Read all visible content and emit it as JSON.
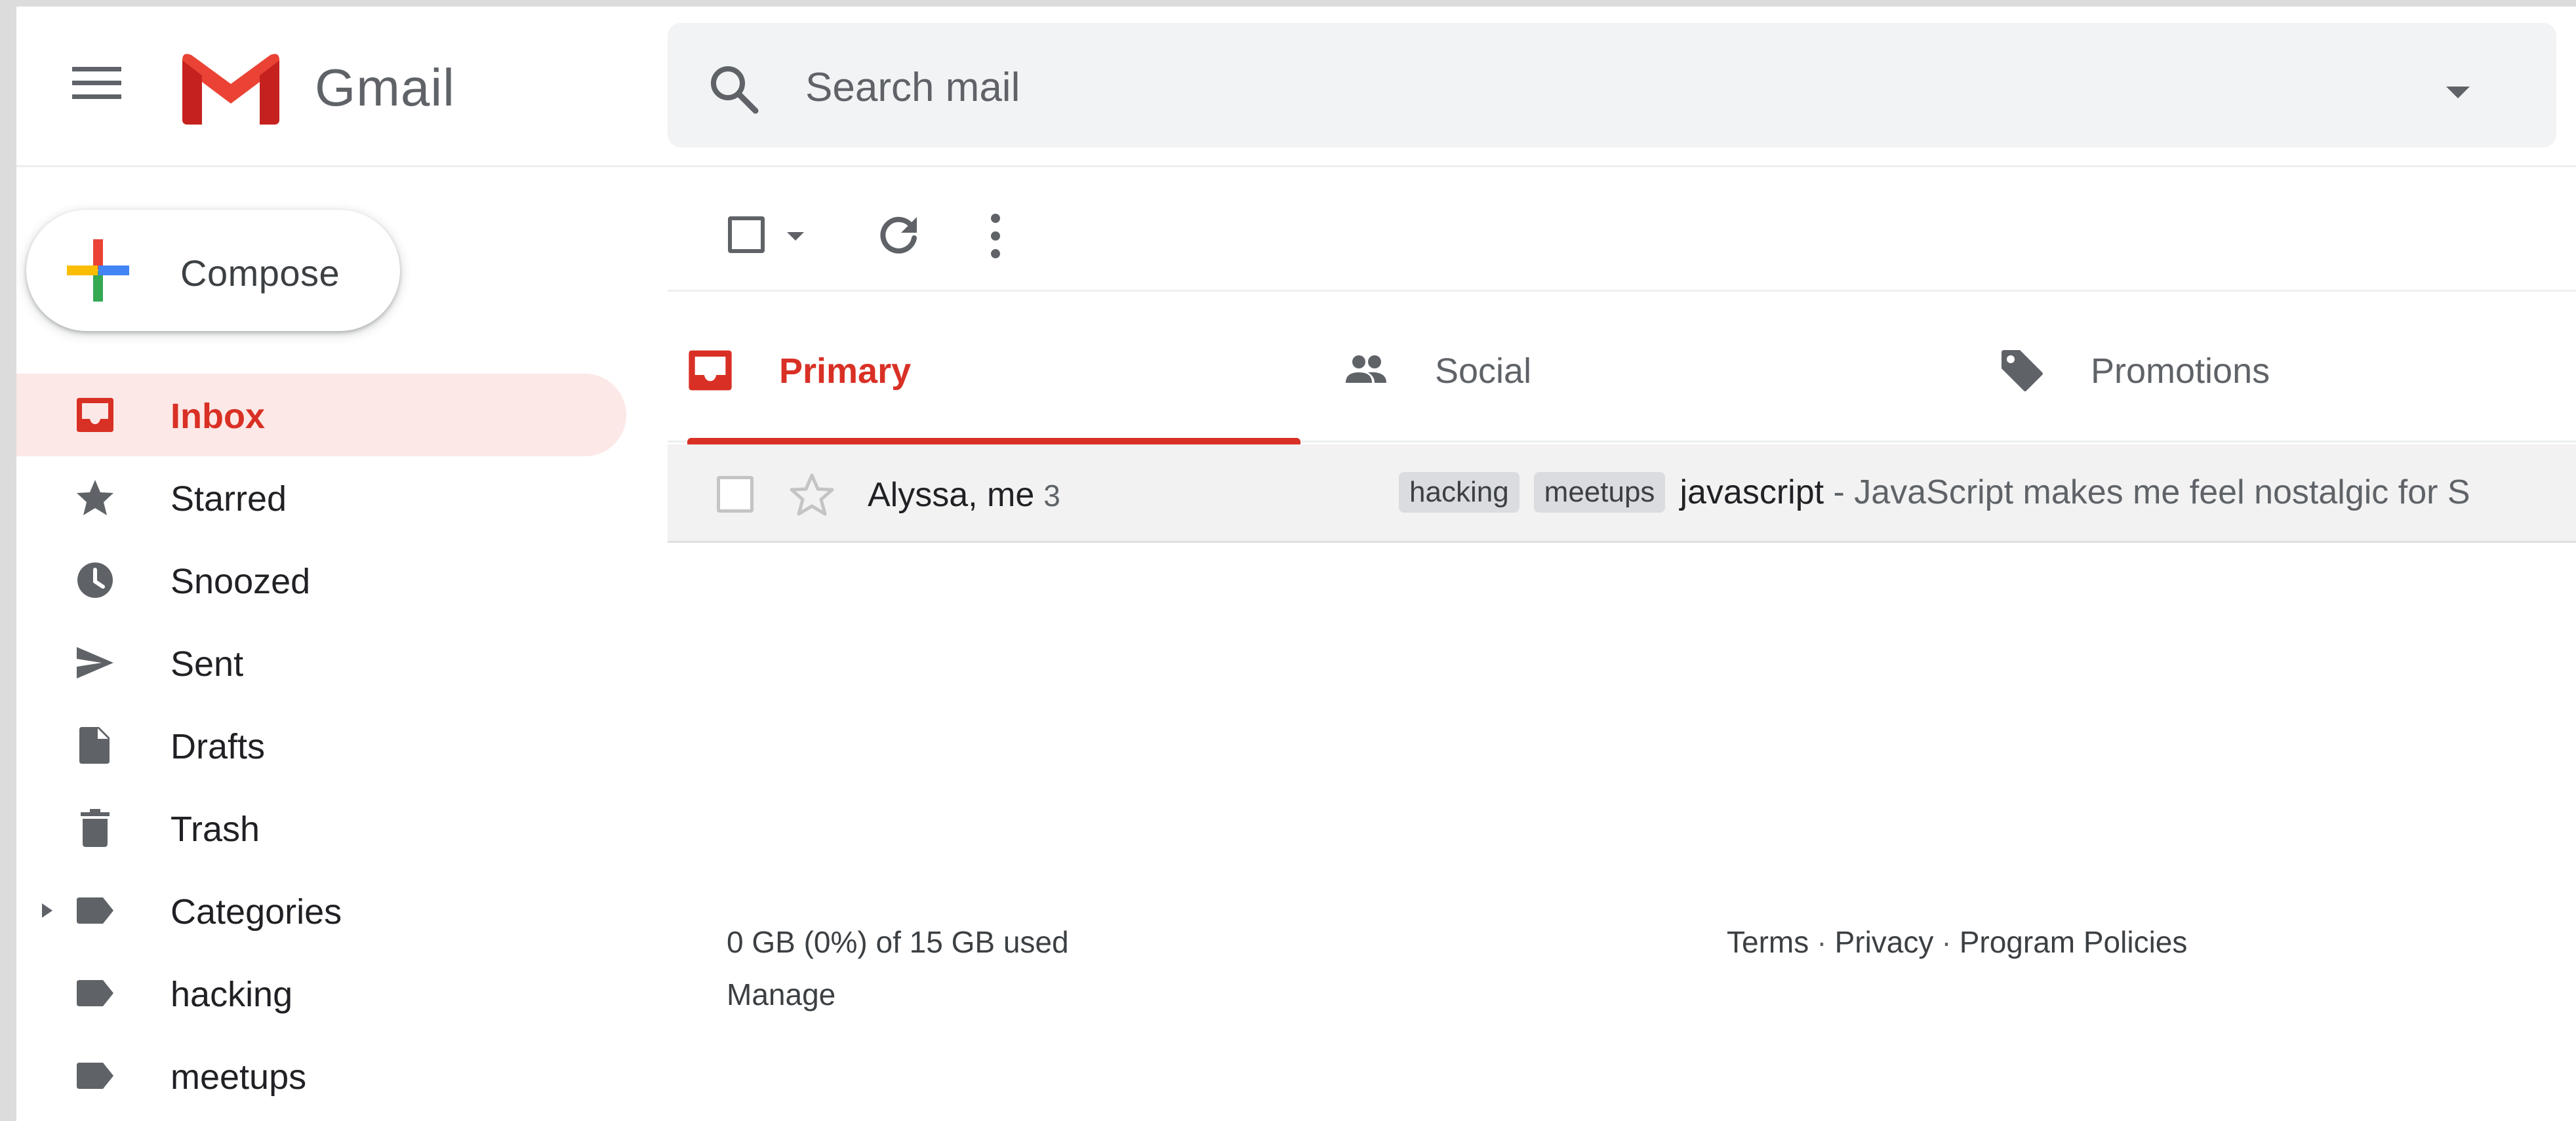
{
  "header": {
    "logo_text": "Gmail",
    "search": {
      "placeholder": "Search mail"
    }
  },
  "compose": {
    "label": "Compose"
  },
  "sidebar": {
    "items": [
      {
        "label": "Inbox",
        "icon": "inbox-icon",
        "active": true
      },
      {
        "label": "Starred",
        "icon": "star-icon"
      },
      {
        "label": "Snoozed",
        "icon": "clock-icon"
      },
      {
        "label": "Sent",
        "icon": "send-icon"
      },
      {
        "label": "Drafts",
        "icon": "draft-icon"
      },
      {
        "label": "Trash",
        "icon": "trash-icon"
      },
      {
        "label": "Categories",
        "icon": "label-icon"
      },
      {
        "label": "hacking",
        "icon": "label-icon"
      },
      {
        "label": "meetups",
        "icon": "label-icon"
      }
    ]
  },
  "tabs": [
    {
      "label": "Primary",
      "icon": "inbox-icon",
      "active": true
    },
    {
      "label": "Social",
      "icon": "people-icon"
    },
    {
      "label": "Promotions",
      "icon": "tag-icon"
    }
  ],
  "emails": [
    {
      "sender": "Alyssa, me",
      "count": "3",
      "labels": [
        "hacking",
        "meetups"
      ],
      "subject": "javascript",
      "snippet": " - JavaScript makes me feel nostalgic for S"
    }
  ],
  "footer": {
    "storage": "0 GB (0%) of 15 GB used",
    "manage": "Manage",
    "links": [
      "Terms",
      "Privacy",
      "Program Policies"
    ],
    "separator": "·"
  },
  "colors": {
    "accent": "#d93025",
    "active_bg": "#fce8e6",
    "search_bg": "#f1f3f4"
  }
}
